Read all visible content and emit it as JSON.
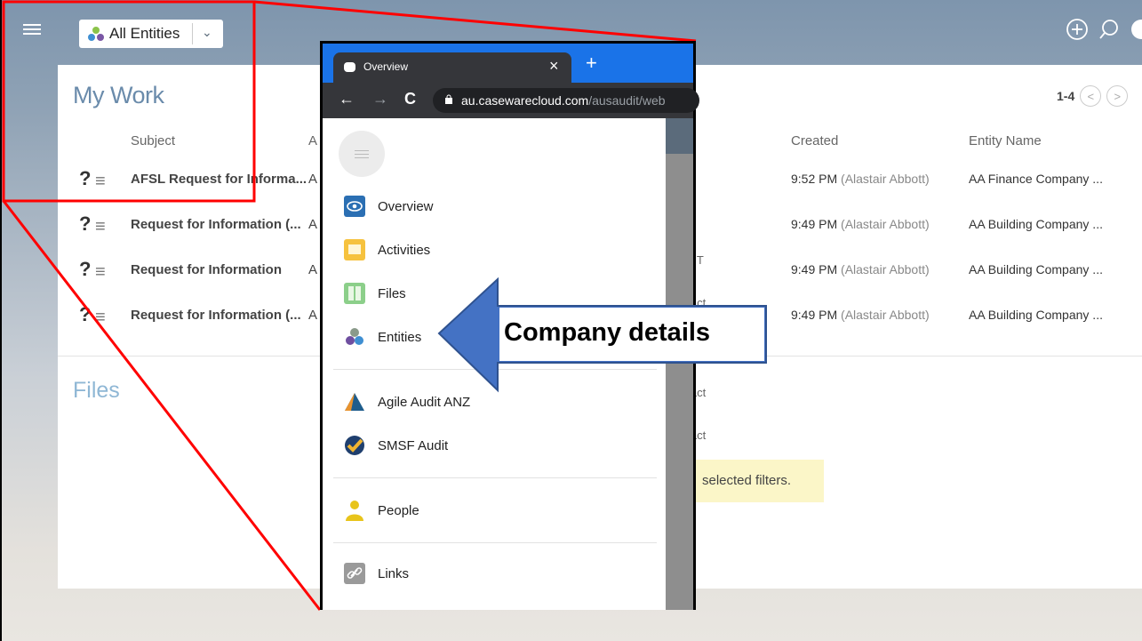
{
  "header": {
    "entity_selector_label": "All Entities",
    "icons": [
      "menu-icon",
      "entities-icon",
      "chevron-down-icon",
      "add-circle-icon",
      "search-icon",
      "avatar-icon"
    ]
  },
  "my_work": {
    "title": "My Work",
    "pager": "1-4",
    "columns": {
      "subject": "Subject",
      "assigned_partial": "A",
      "created": "Created",
      "entity": "Entity Name"
    },
    "rows": [
      {
        "subject": "AFSL Request for Informa...",
        "a": "A",
        "time": "9:52 PM",
        "by": "(Alastair Abbott)",
        "entity": "AA Finance Company ..."
      },
      {
        "subject": "Request for Information (...",
        "a": "A",
        "time": "9:49 PM",
        "by": "(Alastair Abbott)",
        "entity": "AA Building Company ..."
      },
      {
        "subject": "Request for Information",
        "a": "A",
        "time": "9:49 PM",
        "by": "(Alastair Abbott)",
        "entity": "AA Building Company ..."
      },
      {
        "subject": "Request for Information (...",
        "a": "A",
        "time": "9:49 PM",
        "by": "(Alastair Abbott)",
        "entity": "AA Building Company ..."
      }
    ],
    "row_icon_text": "?",
    "row_icon_lines": "≡"
  },
  "files": {
    "title": "Files",
    "notice": "selected filters.",
    "partials": [
      "ed T",
      "ntact",
      "ntact",
      "ntact"
    ]
  },
  "browser": {
    "tab_title": "Overview",
    "tab_close": "×",
    "new_tab": "+",
    "url_host": "au.casewarecloud.com",
    "url_path": "/ausaudit/web",
    "nav_back": "←",
    "nav_forward": "→",
    "nav_reload": "C"
  },
  "menu": {
    "items": [
      {
        "label": "Overview",
        "icon": "overview-eye-icon"
      },
      {
        "label": "Activities",
        "icon": "activities-icon"
      },
      {
        "label": "Files",
        "icon": "files-icon"
      },
      {
        "label": "Entities",
        "icon": "entities-icon"
      },
      {
        "label": "Agile Audit ANZ",
        "icon": "agile-audit-icon"
      },
      {
        "label": "SMSF Audit",
        "icon": "smsf-audit-icon"
      },
      {
        "label": "People",
        "icon": "people-icon"
      },
      {
        "label": "Links",
        "icon": "links-icon"
      }
    ]
  },
  "callout": {
    "text": "Company details",
    "color": "#4472c4"
  },
  "colors": {
    "highlight_red": "#ff0000",
    "chrome_blue": "#1a73e8",
    "title_blue": "#6a8bab"
  }
}
